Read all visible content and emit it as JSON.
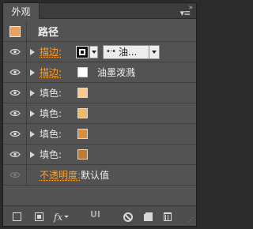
{
  "panel": {
    "tab_title": "外观",
    "menu_icon": "panel-menu-icon",
    "collapse_icon": "collapse-icon"
  },
  "path_row": {
    "label": "路径",
    "swatch_color": "#e8a25b"
  },
  "rows": [
    {
      "label": "描边:",
      "type": "stroke",
      "brush": "油...",
      "link": true
    },
    {
      "label": "描边:",
      "type": "stroke-brush",
      "brush_name": "油墨泼溅",
      "swatch_color": "#ffffff",
      "link": true
    },
    {
      "label": "填色:",
      "type": "fill",
      "swatch_color": "#f9c98c",
      "link": false
    },
    {
      "label": "填色:",
      "type": "fill",
      "swatch_color": "#f2b768",
      "link": false
    },
    {
      "label": "填色:",
      "type": "fill",
      "swatch_color": "#d88e3e",
      "link": false
    },
    {
      "label": "填色:",
      "type": "fill",
      "swatch_color": "#c27a2e",
      "link": false
    }
  ],
  "opacity": {
    "label": "不透明度:",
    "value": "默认值"
  },
  "footer": {
    "icons": [
      "add-new-stroke-icon",
      "add-new-fill-icon",
      "add-effect-icon",
      "clear-appearance-icon",
      "duplicate-item-icon",
      "delete-item-icon"
    ],
    "fx_label": "fx",
    "watermark": "UI"
  },
  "colors": {
    "link_orange": "#f5a33a",
    "panel_bg": "#535353",
    "tab_bar": "#3c3c3c"
  }
}
